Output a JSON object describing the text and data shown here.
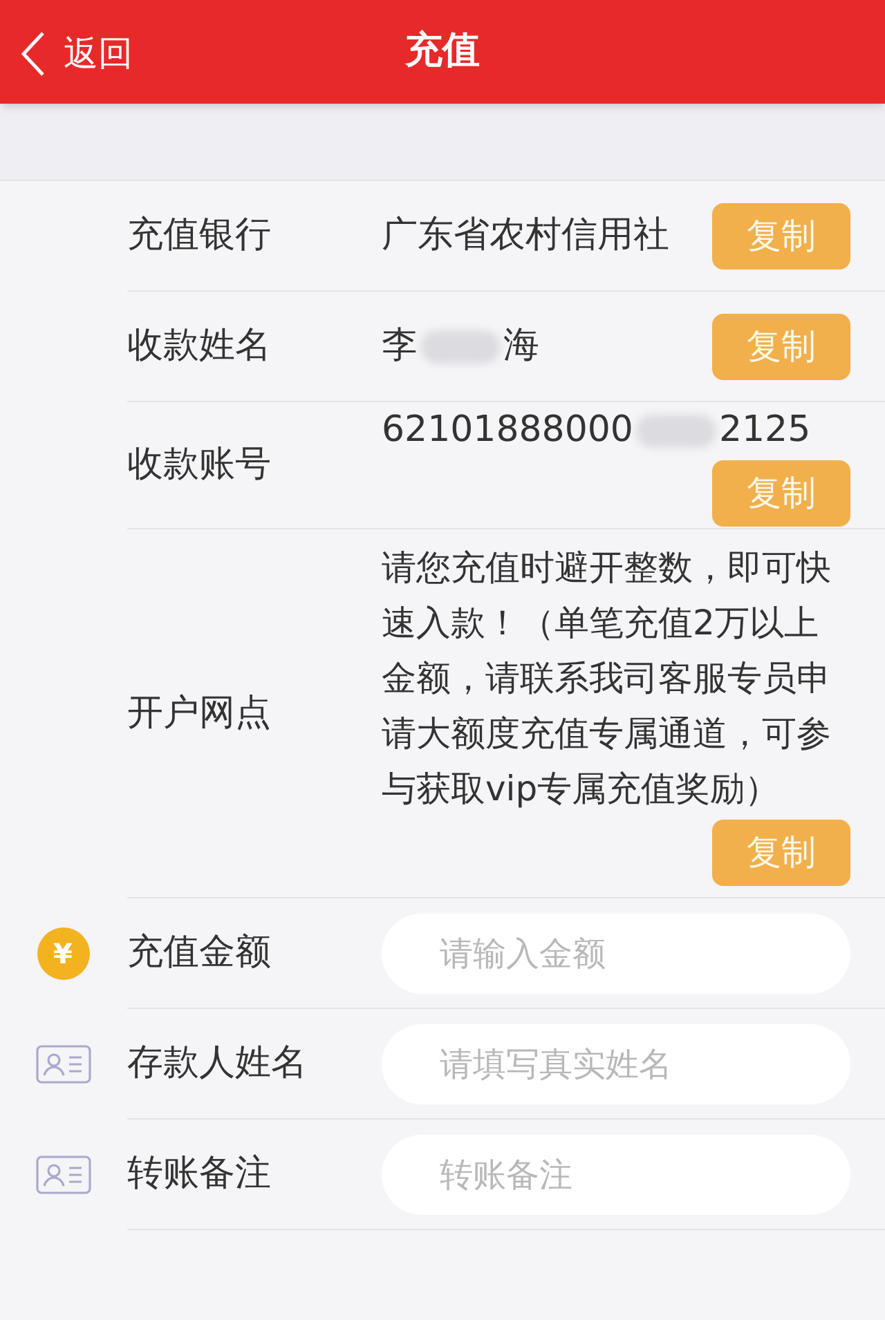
{
  "header": {
    "back_label": "返回",
    "title": "充值"
  },
  "info_rows": [
    {
      "label": "充值银行",
      "value_parts": [
        "广东省农村信用社"
      ],
      "button": "复制"
    },
    {
      "label": "收款姓名",
      "value_parts": [
        "李",
        "海"
      ],
      "button": "复制"
    },
    {
      "label": "收款账号",
      "value_parts": [
        "62101888000",
        "2125"
      ],
      "button": "复制"
    },
    {
      "label": "开户网点",
      "value_parts": [
        "请您充值时避开整数，即可快速入款！（单笔充值2万以上金额，请联系我司客服专员申请大额度充值专属通道，可参与获取vip专属充值奖励）"
      ],
      "button": "复制"
    }
  ],
  "input_rows": [
    {
      "kind": "coin",
      "icon_text": "¥",
      "label": "充值金额",
      "placeholder": "请输入金额"
    },
    {
      "kind": "card",
      "label": "存款人姓名",
      "placeholder": "请填写真实姓名"
    },
    {
      "kind": "card",
      "label": "转账备注",
      "placeholder": "转账备注"
    }
  ]
}
